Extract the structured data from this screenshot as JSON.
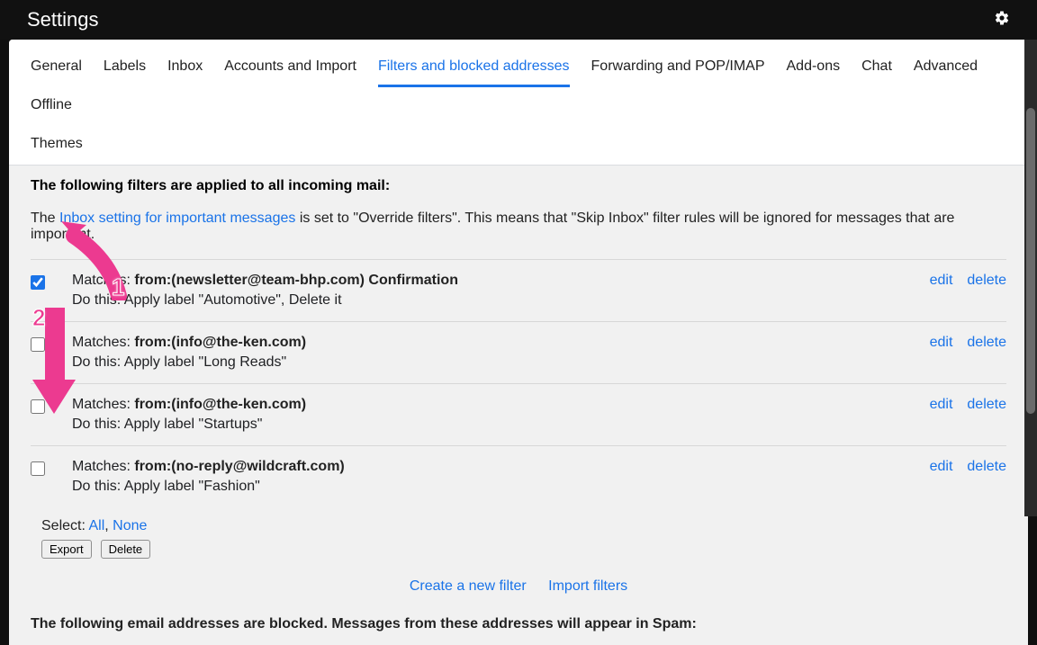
{
  "header": {
    "title": "Settings"
  },
  "tabs": [
    "General",
    "Labels",
    "Inbox",
    "Accounts and Import",
    "Filters and blocked addresses",
    "Forwarding and POP/IMAP",
    "Add-ons",
    "Chat",
    "Advanced",
    "Offline",
    "Themes"
  ],
  "activeTabIndex": 4,
  "intro": "The following filters are applied to all incoming mail:",
  "inboxSetting": {
    "prefix": "The ",
    "link": "Inbox setting for important messages",
    "suffix": " is set to \"Override filters\". This means that \"Skip Inbox\" filter rules will be ignored for messages that are important."
  },
  "filters": [
    {
      "checked": true,
      "matches": "from:(newsletter@team-bhp.com) Confirmation",
      "action": "Apply label \"Automotive\", Delete it"
    },
    {
      "checked": false,
      "matches": "from:(info@the-ken.com)",
      "action": "Apply label \"Long Reads\""
    },
    {
      "checked": false,
      "matches": "from:(info@the-ken.com)",
      "action": "Apply label \"Startups\""
    },
    {
      "checked": false,
      "matches": "from:(no-reply@wildcraft.com)",
      "action": "Apply label \"Fashion\""
    }
  ],
  "labels": {
    "matchesPrefix": "Matches: ",
    "doThisPrefix": "Do this: ",
    "edit": "edit",
    "delete": "delete",
    "selectPrefix": "Select: ",
    "selectAll": "All",
    "selectNone": "None",
    "exportBtn": "Export",
    "deleteBtn": "Delete",
    "createFilter": "Create a new filter",
    "importFilters": "Import filters"
  },
  "blockedHeading": "The following email addresses are blocked. Messages from these addresses will appear in Spam:",
  "annotations": {
    "num1": "1",
    "num2": "2"
  }
}
